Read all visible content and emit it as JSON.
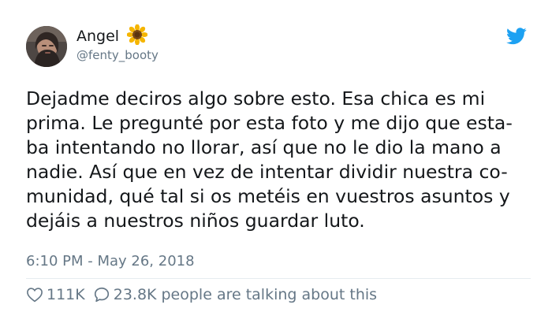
{
  "author": {
    "name": "Angel",
    "name_emoji": "sunflower-icon",
    "handle": "@fenty_booty"
  },
  "tweet": {
    "lines": [
      "Dejadme deciros algo sobre esto. Esa chica es mi",
      "prima. Le pregunté por esta foto y me dijo que esta-",
      "ba intentando no llorar, así que no le dio la mano a",
      "nadie. Así que en vez de intentar dividir nuestra co-",
      "munidad, qué tal si os metéis en vuestros asuntos y",
      "dejáis a nuestros niños guardar luto."
    ],
    "timestamp": "6:10 PM - May 26, 2018"
  },
  "engagement": {
    "likes": "111K",
    "replies": "23.8K",
    "talking_text": "people are talking about this"
  },
  "icons": {
    "brand": "twitter-bird-icon",
    "like": "heart-icon",
    "reply": "speech-bubble-icon"
  },
  "colors": {
    "twitter_blue": "#1da1f2",
    "secondary_text": "#657786",
    "primary_text": "#14171a",
    "divider": "#e6ecf0"
  }
}
